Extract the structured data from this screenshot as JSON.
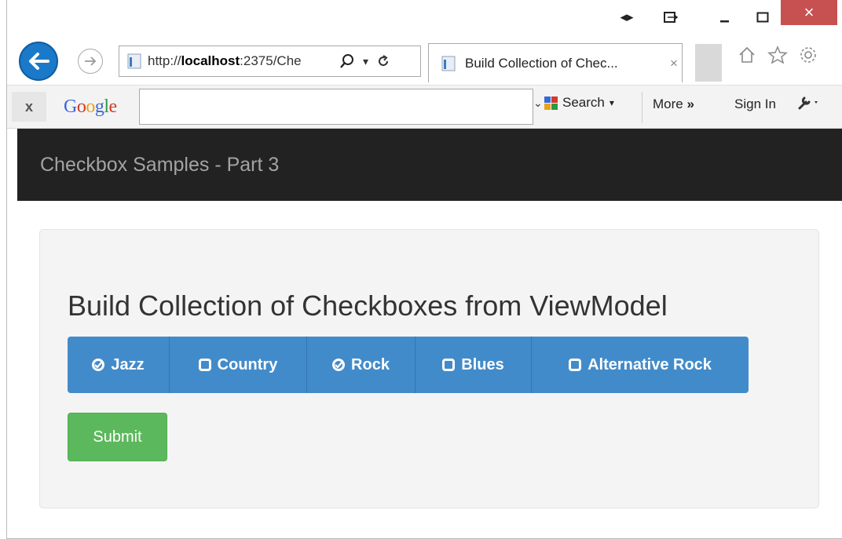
{
  "browser": {
    "address_prefix": "http://",
    "address_host": "localhost",
    "address_rest": ":2375/Che",
    "tab_title": "Build Collection of Chec...",
    "tab_close": "×",
    "window_close": "×"
  },
  "google_toolbar": {
    "close_label": "x",
    "logo": "Google",
    "search_value": "",
    "search_label": "Search",
    "more_label": "More",
    "more_chevron": "»",
    "signin_label": "Sign In"
  },
  "page": {
    "brand": "Checkbox Samples - Part 3",
    "heading": "Build Collection of Checkboxes from ViewModel",
    "checkboxes": [
      {
        "label": "Jazz",
        "checked": true
      },
      {
        "label": "Country",
        "checked": false
      },
      {
        "label": "Rock",
        "checked": true
      },
      {
        "label": "Blues",
        "checked": false
      },
      {
        "label": "Alternative Rock",
        "checked": false
      }
    ],
    "submit_label": "Submit"
  },
  "colors": {
    "navbar": "#222222",
    "button_primary": "#428bca",
    "button_success": "#5cb85c",
    "window_close": "#c75050",
    "back_button": "#1a79c9"
  }
}
